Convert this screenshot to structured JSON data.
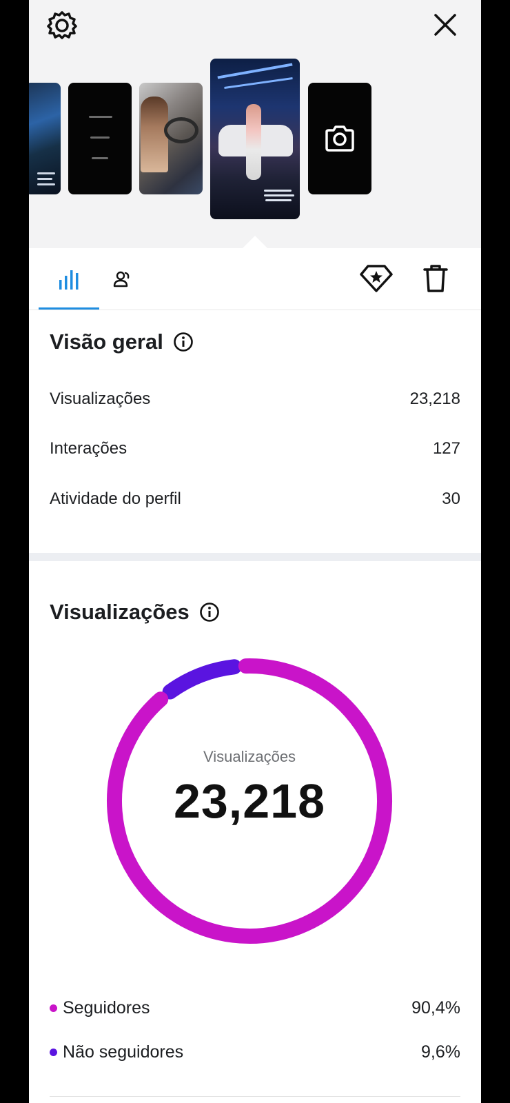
{
  "overview": {
    "title": "Visão geral",
    "rows": [
      {
        "label": "Visualizações",
        "value": "23,218"
      },
      {
        "label": "Interações",
        "value": "127"
      },
      {
        "label": "Atividade do perfil",
        "value": "30"
      }
    ]
  },
  "views": {
    "title": "Visualizações",
    "center_label": "Visualizações",
    "center_value": "23,218",
    "legend": [
      {
        "label": "Seguidores",
        "value": "90,4%",
        "color": "#c914c9"
      },
      {
        "label": "Não seguidores",
        "value": "9,6%",
        "color": "#5a14e0"
      }
    ]
  },
  "chart_data": {
    "type": "pie",
    "categories": [
      "Seguidores",
      "Não seguidores"
    ],
    "values": [
      90.4,
      9.6
    ],
    "colors": [
      "#c914c9",
      "#5a14e0"
    ]
  },
  "colors": {
    "accent": "#1f8de0",
    "followers": "#c914c9",
    "non_followers": "#5a14e0"
  },
  "icons": {
    "settings": "gear-icon",
    "close": "close-icon",
    "camera": "camera-icon",
    "stats_tab": "bar-chart-icon",
    "audience_tab": "people-icon",
    "boost": "badge-star-icon",
    "delete": "trash-icon",
    "info": "info-icon"
  }
}
